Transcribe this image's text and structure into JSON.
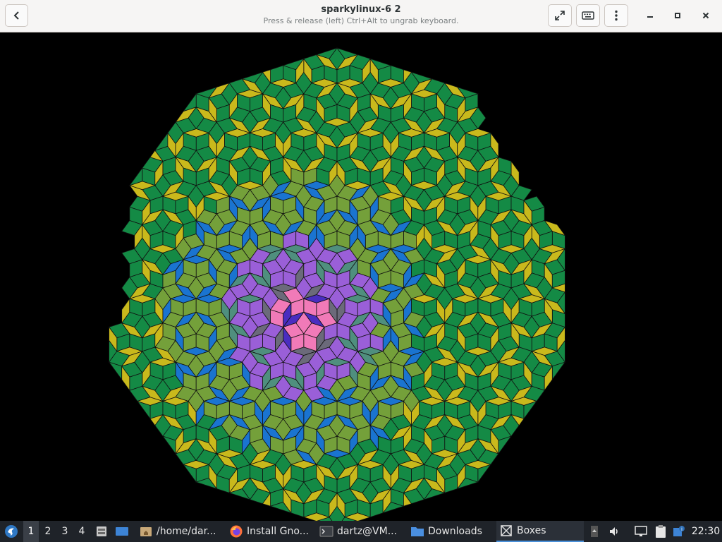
{
  "window": {
    "title": "sparkylinux-6 2",
    "subtitle": "Press & release (left) Ctrl+Alt to ungrab keyboard."
  },
  "headerbar": {
    "icons": [
      "back-arrow-icon",
      "fullscreen-icon",
      "keyboard-icon",
      "kebab-menu-icon",
      "minimize-icon",
      "maximize-icon",
      "close-icon"
    ]
  },
  "vm_display": {
    "content": "penrose-tiling",
    "colors": {
      "green": "#148a45",
      "yellow": "#c9b91c",
      "olive": "#74a03a",
      "blue": "#1a74d0",
      "purple": "#9a5fd8",
      "teal": "#4f8f7e",
      "pink": "#f17ab8",
      "indigo": "#4a2dc0",
      "gray": "#6b6a7a"
    }
  },
  "taskbar": {
    "workspaces": [
      "1",
      "2",
      "3",
      "4"
    ],
    "active_workspace": "1",
    "tasks": [
      {
        "label": "/home/dar...",
        "icon": "folder-home-icon"
      },
      {
        "label": "Install Gno...",
        "icon": "firefox-icon"
      },
      {
        "label": "dartz@VM...",
        "icon": "terminal-icon"
      },
      {
        "label": "Downloads",
        "icon": "folder-icon"
      },
      {
        "label": "Boxes",
        "icon": "boxes-icon"
      }
    ],
    "active_task": "Boxes",
    "clock": "22:30",
    "tray_icons": [
      "scroll-up-icon",
      "volume-icon",
      "network-icon",
      "clipboard-icon",
      "updates-icon"
    ]
  }
}
